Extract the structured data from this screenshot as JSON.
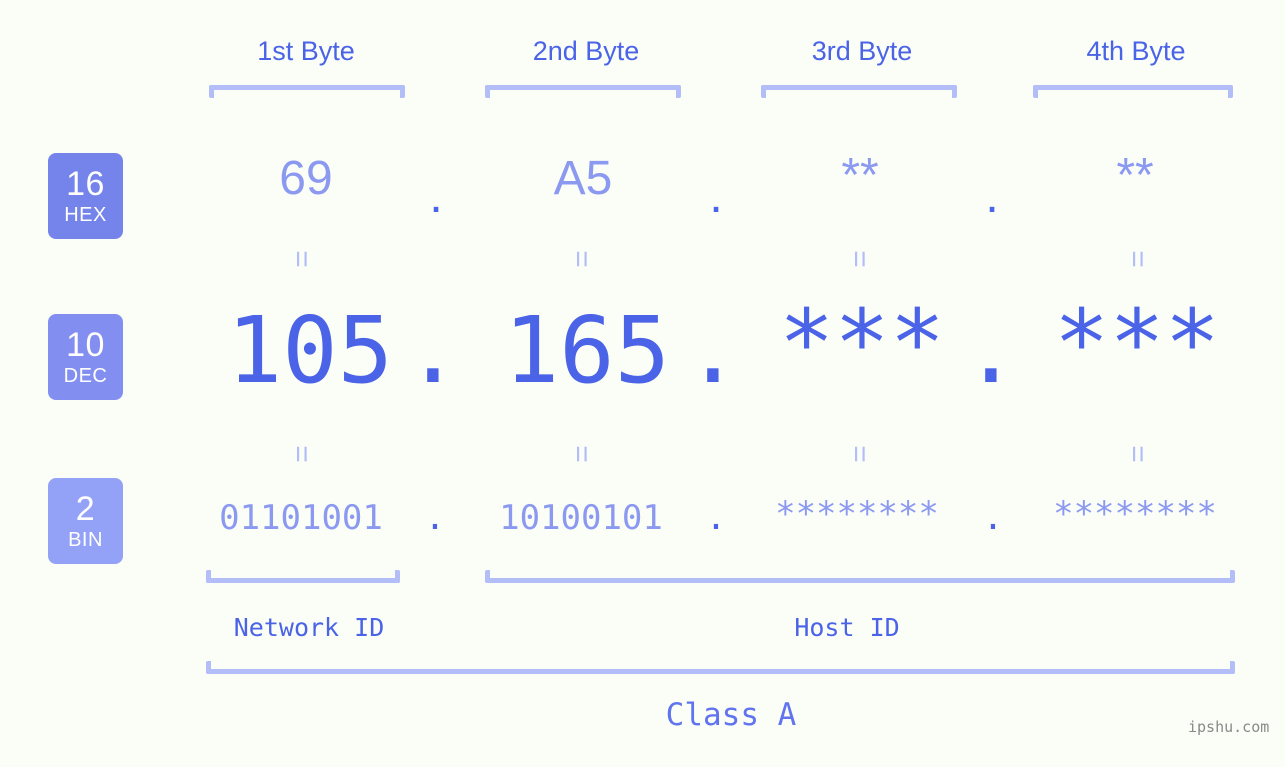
{
  "meta": {
    "background": "#fbfdf7",
    "accent_strong": "#4a63e7",
    "accent_light": "#8b99f0",
    "bracket_color": "#b3bdf7",
    "watermark": "ipshu.com"
  },
  "byte_headers": [
    {
      "label": "1st Byte"
    },
    {
      "label": "2nd Byte"
    },
    {
      "label": "3rd Byte"
    },
    {
      "label": "4th Byte"
    }
  ],
  "radix_badges": [
    {
      "number": "16",
      "name": "HEX",
      "color": "#7484ea"
    },
    {
      "number": "10",
      "name": "DEC",
      "color": "#838ff0"
    },
    {
      "number": "2",
      "name": "BIN",
      "color": "#93a2f7"
    }
  ],
  "rows": {
    "hex": {
      "values": [
        "69",
        "A5",
        "**",
        "**"
      ],
      "separator": "."
    },
    "dec": {
      "values": [
        "105",
        "165",
        "***",
        "***"
      ],
      "separator": "."
    },
    "bin": {
      "values": [
        "01101001",
        "10100101",
        "********",
        "********"
      ],
      "separator": "."
    }
  },
  "equals_symbol": "=",
  "id_labels": [
    {
      "text": "Network ID"
    },
    {
      "text": "Host ID"
    }
  ],
  "class_label": "Class A"
}
